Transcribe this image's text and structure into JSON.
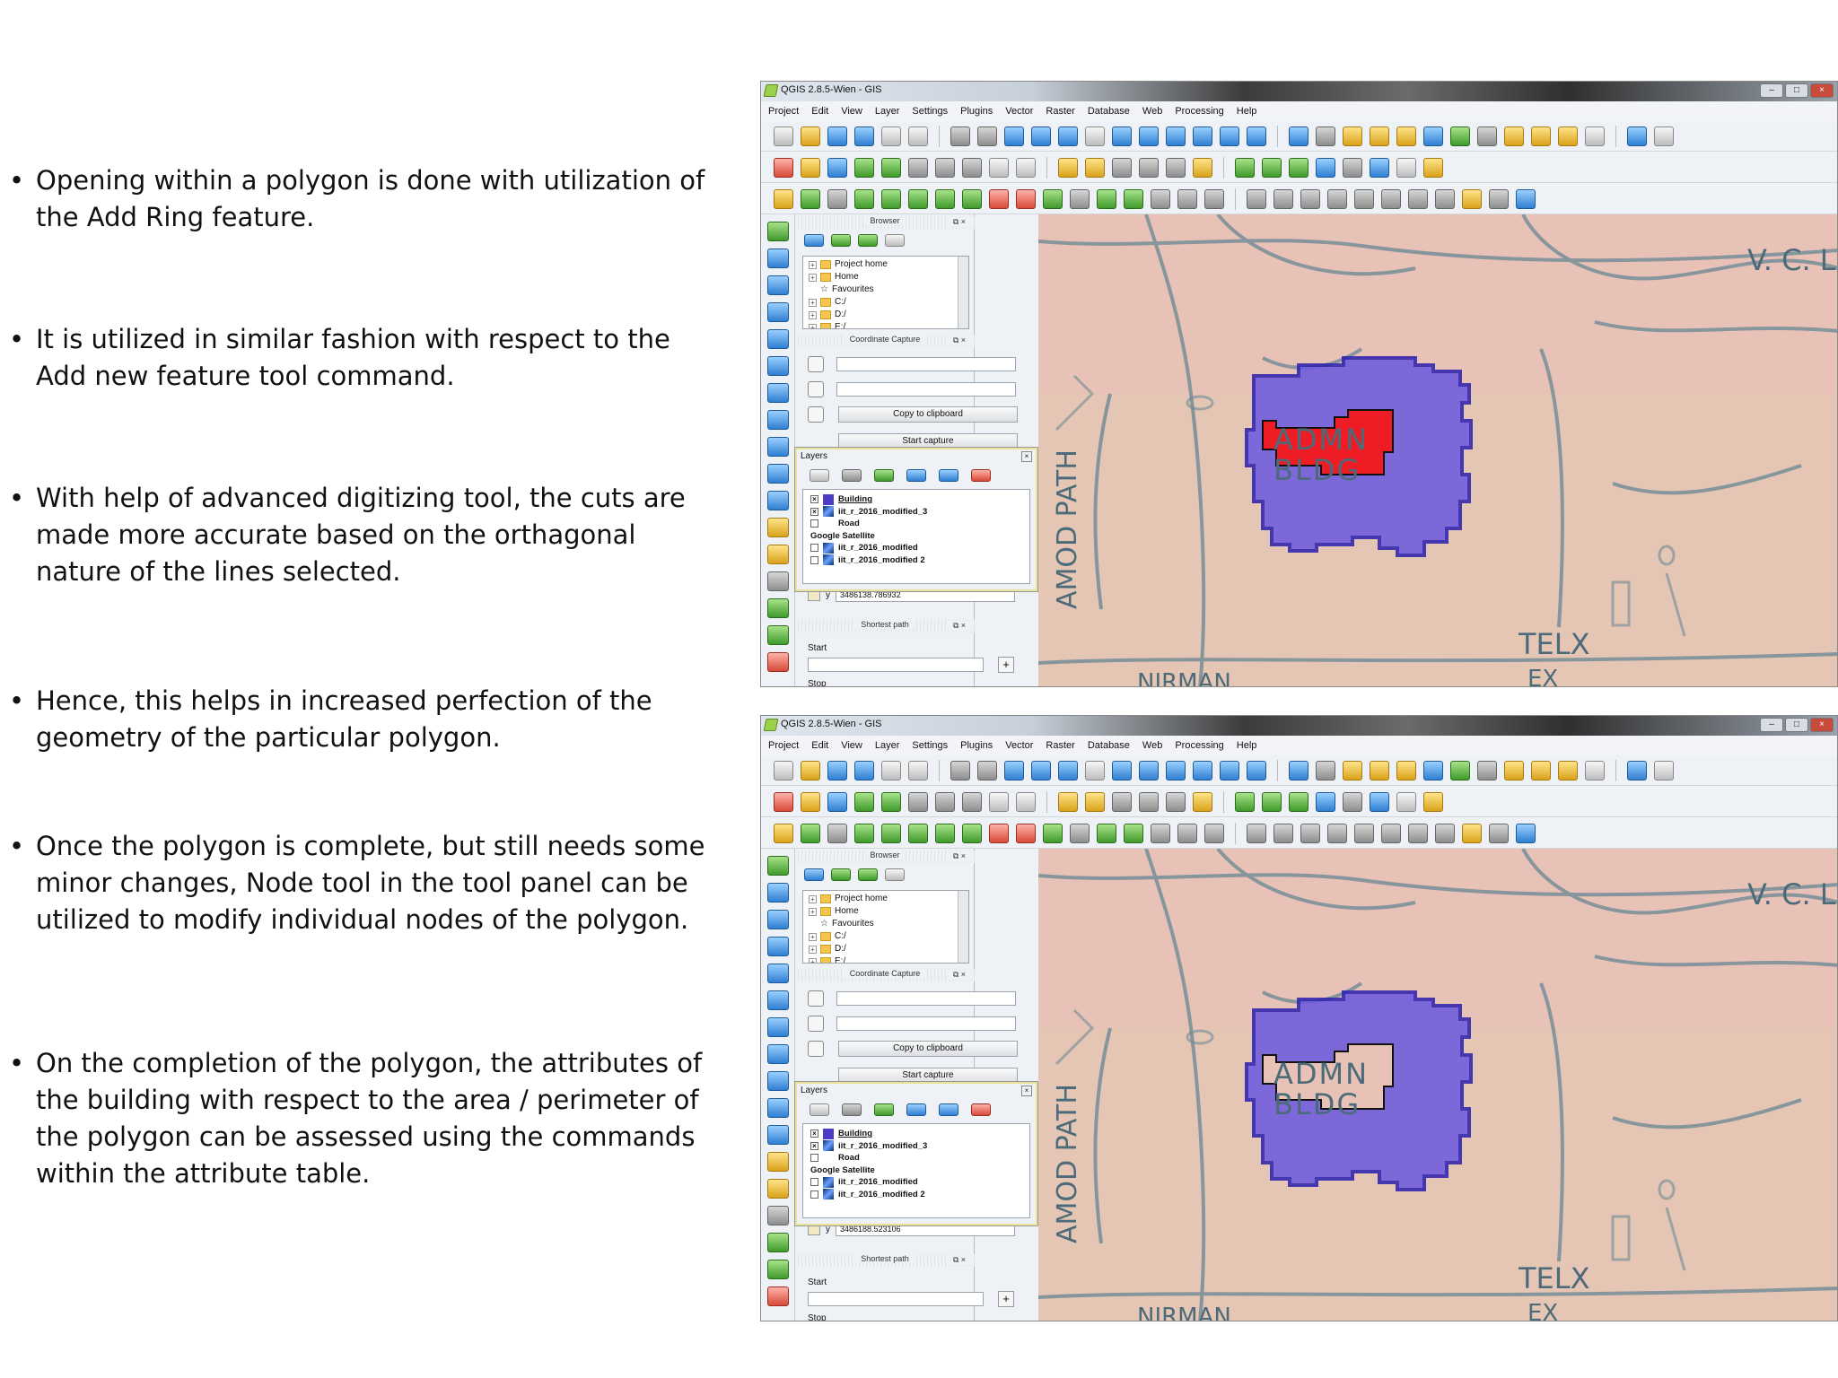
{
  "bullets": [
    {
      "dot": "•",
      "text": "Opening within a polygon is done with utilization of the Add Ring feature."
    },
    {
      "dot": "•",
      "text": "It is utilized in similar fashion with respect to the Add new feature tool command."
    },
    {
      "dot": "•",
      "text": "With help of advanced digitizing tool, the cuts are made more accurate based on the orthagonal nature of the lines selected."
    },
    {
      "dot": "•",
      "text": "Hence, this helps in increased perfection of the geometry of the particular polygon."
    },
    {
      "dot": "•",
      "text": "Once the polygon is complete, but still needs some minor changes, Node tool in the tool panel can be utilized to modify individual nodes of the polygon."
    },
    {
      "dot": "•",
      "text": "On the completion of the polygon, the attributes of the building with respect to the  area / perimeter of the polygon can be assessed using the commands within the attribute table."
    }
  ],
  "windows": [
    {
      "title": "QGIS 2.8.5-Wien - GIS",
      "menu": [
        "Project",
        "Edit",
        "View",
        "Layer",
        "Settings",
        "Plugins",
        "Vector",
        "Raster",
        "Database",
        "Web",
        "Processing",
        "Help"
      ],
      "browser": {
        "title": "Browser",
        "items": [
          "Project home",
          "Home",
          "Favourites",
          "C:/",
          "D:/",
          "E:/"
        ]
      },
      "coord_capture": {
        "title": "Coordinate Capture",
        "copy_button": "Copy to clipboard",
        "start_button": "Start capture"
      },
      "layers": {
        "title": "Layers",
        "items": [
          {
            "name": "Building",
            "checked": "×"
          },
          {
            "name": "iit_r_2016_modified_3",
            "checked": "×"
          },
          {
            "name": "Road",
            "checked": ""
          },
          {
            "name": "Google Satellite",
            "checked": ""
          },
          {
            "name": "iit_r_2016_modified",
            "checked": ""
          },
          {
            "name": "iit_r_2016_modified 2",
            "checked": ""
          }
        ]
      },
      "y_label": "y",
      "y_value": "3486138.786932",
      "shortest_path": {
        "title": "Shortest path",
        "start_label": "Start",
        "stop_label": "Stop"
      },
      "map_labels": {
        "top_right": "V. C. L",
        "path": "AMOD PATH",
        "telx": "TELX",
        "ex": "EX",
        "bldg1": "ADMN",
        "bldg2": "BLDG",
        "bottom": "NIRMAN"
      },
      "colors": {
        "building_fill": "#6a58e0",
        "ring_fill": "#ee1c25",
        "map_bg": "#e8c2b6"
      }
    },
    {
      "title": "QGIS 2.8.5-Wien - GIS",
      "menu": [
        "Project",
        "Edit",
        "View",
        "Layer",
        "Settings",
        "Plugins",
        "Vector",
        "Raster",
        "Database",
        "Web",
        "Processing",
        "Help"
      ],
      "browser": {
        "title": "Browser",
        "items": [
          "Project home",
          "Home",
          "Favourites",
          "C:/",
          "D:/",
          "E:/"
        ]
      },
      "coord_capture": {
        "title": "Coordinate Capture",
        "copy_button": "Copy to clipboard",
        "start_button": "Start capture"
      },
      "layers": {
        "title": "Layers",
        "items": [
          {
            "name": "Building",
            "checked": "×"
          },
          {
            "name": "iit_r_2016_modified_3",
            "checked": "×"
          },
          {
            "name": "Road",
            "checked": ""
          },
          {
            "name": "Google Satellite",
            "checked": ""
          },
          {
            "name": "iit_r_2016_modified",
            "checked": ""
          },
          {
            "name": "iit_r_2016_modified 2",
            "checked": ""
          }
        ]
      },
      "y_label": "y",
      "y_value": "3486188.523106",
      "shortest_path": {
        "title": "Shortest path",
        "start_label": "Start",
        "stop_label": "Stop"
      },
      "map_labels": {
        "top_right": "V. C. L",
        "path": "AMOD PATH",
        "telx": "TELX",
        "ex": "EX",
        "bldg1": "ADMN",
        "bldg2": "BLDG",
        "bottom": "NIRMAN"
      },
      "colors": {
        "building_fill": "#6a58e0",
        "ring_fill": "#e8c2b6",
        "map_bg": "#e8c2b6"
      }
    }
  ]
}
